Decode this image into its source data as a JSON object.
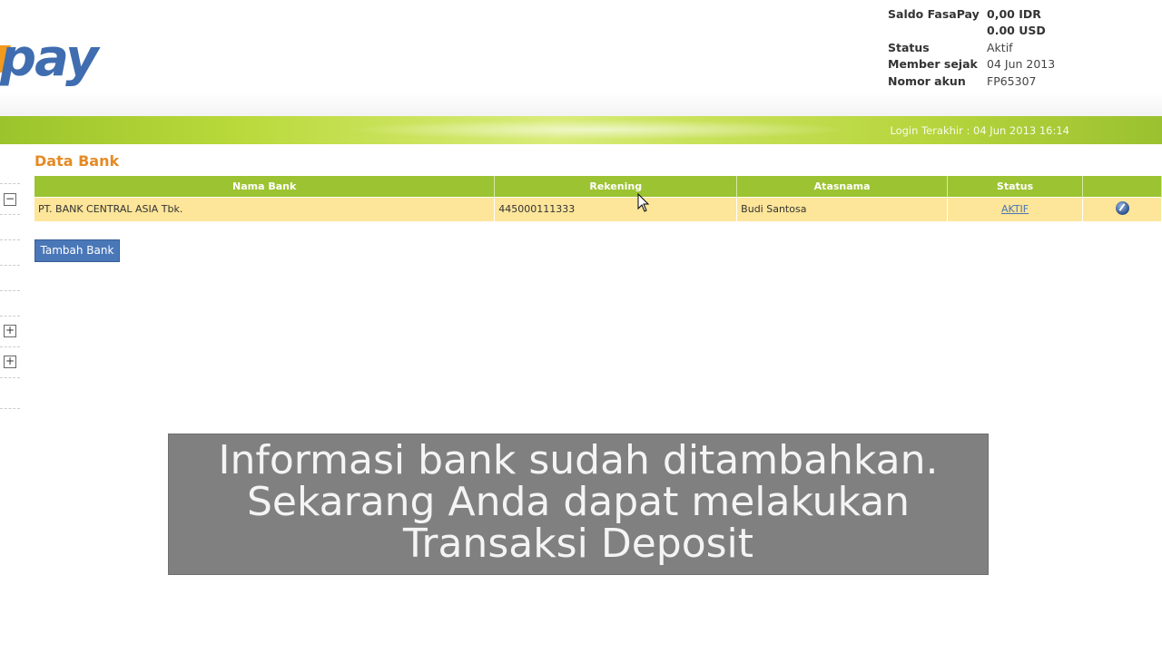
{
  "brand": {
    "logo_text": "pay"
  },
  "account": {
    "rows": [
      {
        "key": "Saldo FasaPay",
        "value": "0,00 IDR"
      },
      {
        "key": "",
        "value": "0.00 USD"
      },
      {
        "key": "Status",
        "value": "Aktif"
      },
      {
        "key": "Member sejak",
        "value": "04 Jun 2013"
      },
      {
        "key": "Nomor akun",
        "value": "FP65307"
      }
    ]
  },
  "banner": {
    "last_login": "Login Terakhir : 04 Jun 2013 16:14"
  },
  "content": {
    "title": "Data Bank",
    "table": {
      "headers": [
        "Nama Bank",
        "Rekening",
        "Atasnama",
        "Status",
        ""
      ],
      "rows": [
        {
          "bank": "PT. BANK CENTRAL ASIA Tbk.",
          "account": "445000111333",
          "holder": "Budi Santosa",
          "status": "AKTIF"
        }
      ]
    },
    "add_button": "Tambah Bank"
  },
  "sidebar": {
    "icons": [
      "minus-box-icon",
      "plus-box-icon",
      "plus-box-icon"
    ]
  },
  "caption": {
    "lines": [
      "Informasi bank sudah ditambahkan.",
      "Sekarang Anda dapat melakukan",
      "Transaksi Deposit"
    ]
  },
  "colors": {
    "header_green": "#9cc331",
    "row_yellow": "#fde599",
    "title_orange": "#e58a25",
    "button_blue": "#4a77b8",
    "caption_gray": "#808080"
  }
}
